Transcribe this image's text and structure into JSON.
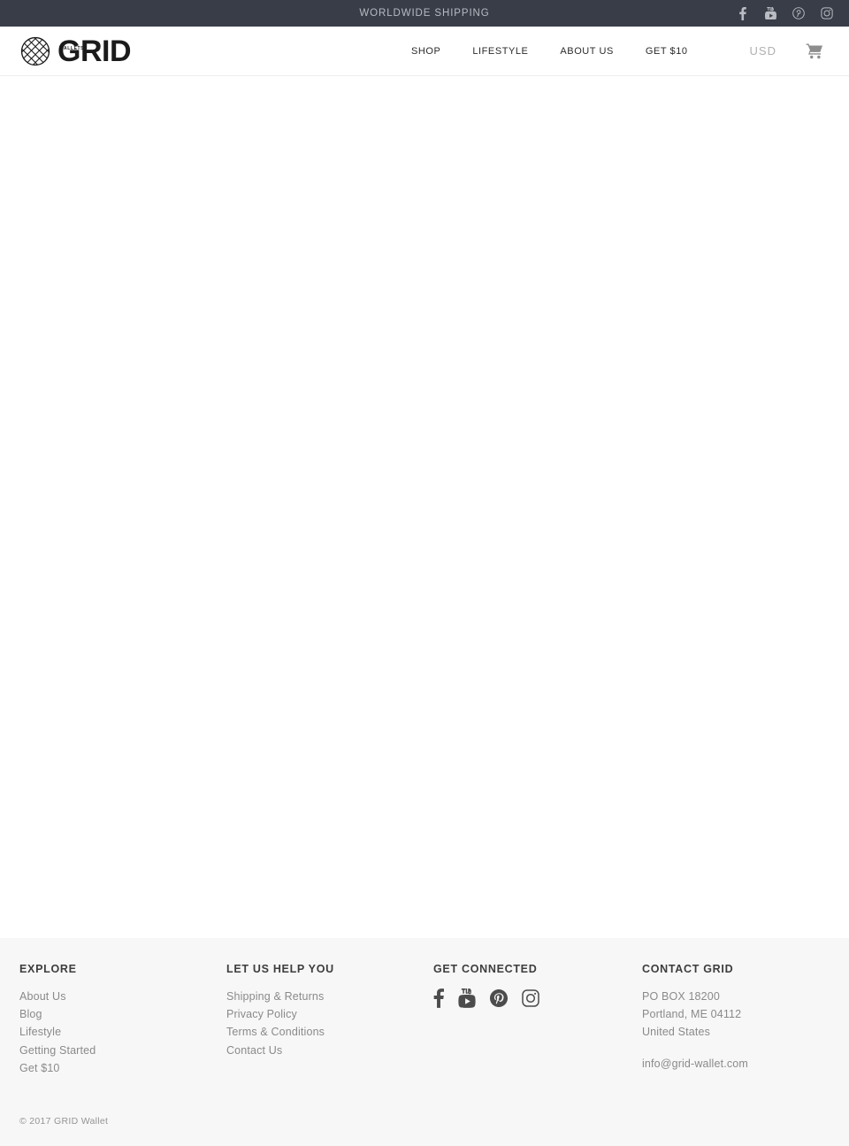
{
  "topbar": {
    "message": "WORLDWIDE SHIPPING",
    "background_color": "#383d48",
    "text_color": "#b7bac1",
    "social": [
      {
        "name": "facebook",
        "icon": "facebook-icon",
        "label": "Facebook"
      },
      {
        "name": "youtube",
        "icon": "youtube-icon",
        "label": "YouTube"
      },
      {
        "name": "pinterest",
        "icon": "pinterest-icon",
        "label": "Pinterest"
      },
      {
        "name": "instagram",
        "icon": "instagram-icon",
        "label": "Instagram"
      }
    ]
  },
  "header": {
    "logo": {
      "wordmark": "GRID",
      "subtext": "WALLETS",
      "icon": "grid-lattice-circle-icon"
    },
    "nav": [
      {
        "label": "SHOP"
      },
      {
        "label": "LIFESTYLE"
      },
      {
        "label": "ABOUT US"
      },
      {
        "label": "GET $10"
      }
    ],
    "currency": "USD",
    "cart": {
      "icon": "shopping-cart-icon",
      "label": "Cart"
    },
    "border_color": "#ededed"
  },
  "main": {
    "content": ""
  },
  "footer": {
    "background_color": "#f7f7f7",
    "columns": [
      {
        "heading": "EXPLORE",
        "links": [
          {
            "label": "About Us"
          },
          {
            "label": "Blog"
          },
          {
            "label": "Lifestyle"
          },
          {
            "label": "Getting Started"
          },
          {
            "label": "Get $10"
          }
        ]
      },
      {
        "heading": "LET US HELP YOU",
        "links": [
          {
            "label": "Shipping & Returns"
          },
          {
            "label": "Privacy Policy"
          },
          {
            "label": "Terms & Conditions"
          },
          {
            "label": "Contact Us"
          }
        ]
      },
      {
        "heading": "GET CONNECTED",
        "social": [
          {
            "name": "facebook",
            "icon": "facebook-icon",
            "label": "Facebook"
          },
          {
            "name": "youtube",
            "icon": "youtube-icon",
            "label": "YouTube"
          },
          {
            "name": "pinterest",
            "icon": "pinterest-icon",
            "label": "Pinterest"
          },
          {
            "name": "instagram",
            "icon": "instagram-icon",
            "label": "Instagram"
          }
        ]
      },
      {
        "heading": "CONTACT GRID",
        "address_lines": [
          "PO BOX 18200",
          "Portland, ME 04112",
          "United States"
        ],
        "email": "info@grid-wallet.com"
      }
    ],
    "copyright": "© 2017 GRID Wallet"
  }
}
